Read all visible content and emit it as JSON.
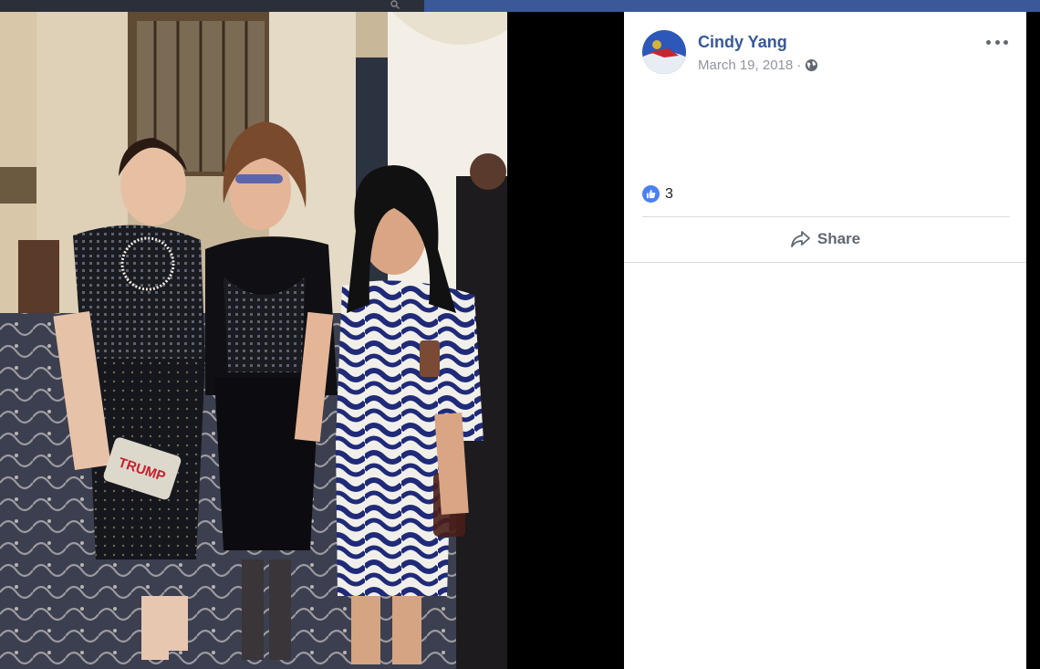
{
  "post": {
    "author": "Cindy Yang",
    "date": "March 19, 2018",
    "date_separator": "·",
    "privacy_icon": "globe-icon",
    "reaction_icon": "like-icon",
    "reaction_count": "3",
    "share_label": "Share",
    "more_icon": "more-options-icon"
  },
  "photo": {
    "clutch_text": "TRUMP"
  },
  "colors": {
    "author_link": "#365899",
    "meta_text": "#90949c",
    "like_blue": "#4a80f0",
    "nav_blue": "#3b5998"
  }
}
